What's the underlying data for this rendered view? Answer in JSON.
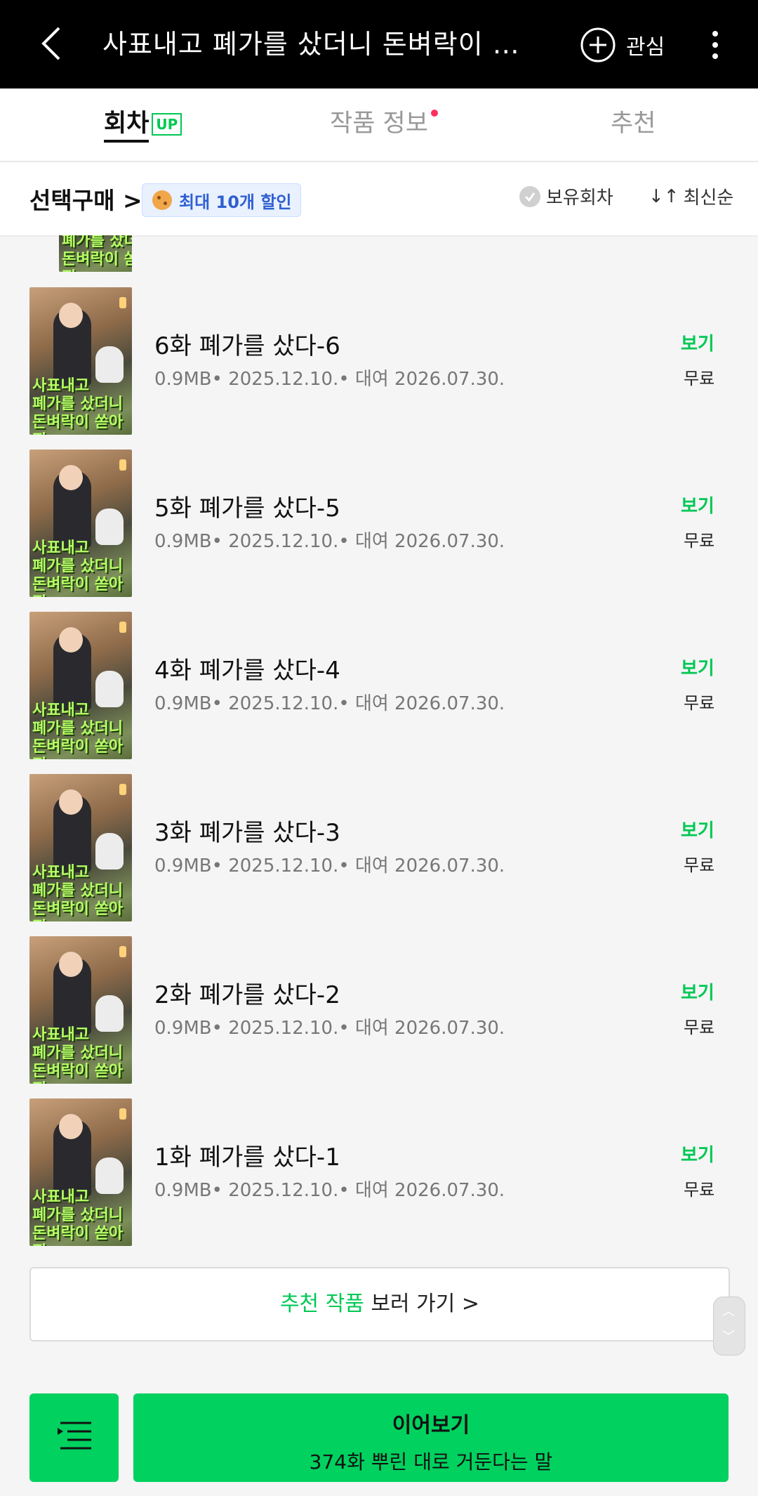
{
  "topbar": {
    "title": "사표내고 폐가를 샀더니 돈벼락이 쏟...",
    "favorite_label": "관심",
    "back_icon": "chevron-left-icon",
    "more_icon": "more-vertical-icon"
  },
  "tabs": [
    {
      "label": "회차",
      "badge": "UP"
    },
    {
      "label": "작품 정보"
    },
    {
      "label": "추천"
    }
  ],
  "filter": {
    "select_buy": "선택구매",
    "discount": "최대 10개 할인",
    "owned": "보유회차",
    "sort": "최신순"
  },
  "thumbnail_text": [
    "사표내고",
    "폐가를 샀더니",
    "돈벼락이 쏟아짐"
  ],
  "episodes": [
    {
      "title": "6화 폐가를 샀다-6",
      "meta": "0.9MB• 2025.12.10.• 대여 2026.07.30.",
      "action": "보기",
      "price": "무료"
    },
    {
      "title": "5화 폐가를 샀다-5",
      "meta": "0.9MB• 2025.12.10.• 대여 2026.07.30.",
      "action": "보기",
      "price": "무료"
    },
    {
      "title": "4화 폐가를 샀다-4",
      "meta": "0.9MB• 2025.12.10.• 대여 2026.07.30.",
      "action": "보기",
      "price": "무료"
    },
    {
      "title": "3화 폐가를 샀다-3",
      "meta": "0.9MB• 2025.12.10.• 대여 2026.07.30.",
      "action": "보기",
      "price": "무료"
    },
    {
      "title": "2화 폐가를 샀다-2",
      "meta": "0.9MB• 2025.12.10.• 대여 2026.07.30.",
      "action": "보기",
      "price": "무료"
    },
    {
      "title": "1화 폐가를 샀다-1",
      "meta": "0.9MB• 2025.12.10.• 대여 2026.07.30.",
      "action": "보기",
      "price": "무료"
    }
  ],
  "recommend": {
    "highlight": "추천 작품",
    "rest": "보러 가기 >"
  },
  "bottom": {
    "continue_label": "이어보기",
    "continue_sub": "374화 뿌린 대로 거둔다는 말"
  },
  "colors": {
    "accent": "#00d15f",
    "view_text": "#00c853",
    "topbar": "#000000"
  }
}
